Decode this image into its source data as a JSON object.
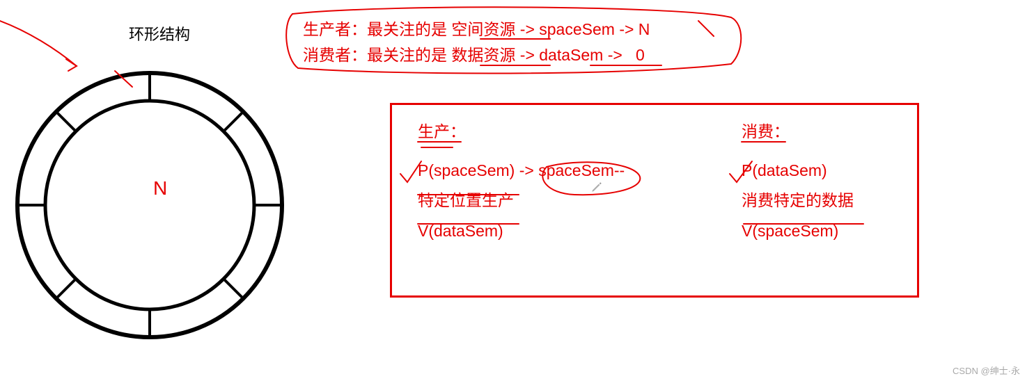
{
  "ring": {
    "title": "环形结构",
    "center_label": "N"
  },
  "notes": {
    "producer": "生产者：最关注的是 空间资源 -> spaceSem -> N",
    "consumer": "消费者：最关注的是 数据资源 -> dataSem ->   0"
  },
  "box": {
    "producer": {
      "title": "生产：",
      "step1": "P(spaceSem) -> spaceSem--",
      "step2": "特定位置生产",
      "step3": "V(dataSem)"
    },
    "consumer": {
      "title": "消费：",
      "step1": "P(dataSem)",
      "step2": "消费特定的数据",
      "step3": "V(spaceSem)"
    }
  },
  "watermark": "CSDN @绅士·永"
}
